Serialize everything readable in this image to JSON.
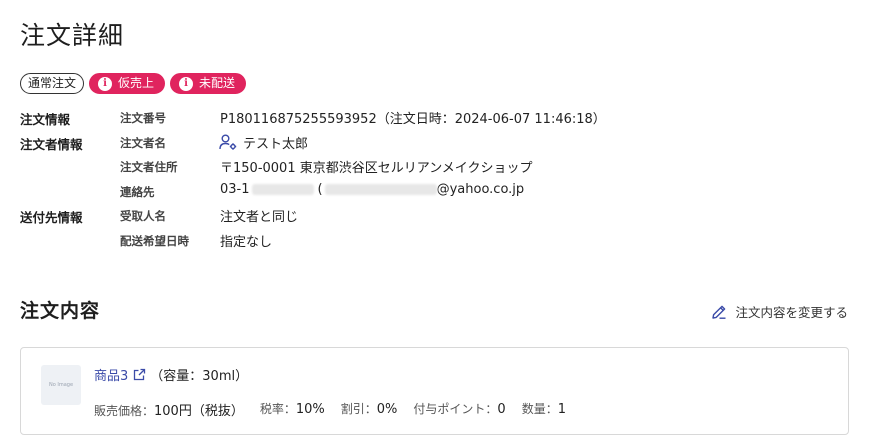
{
  "page_title": "注文詳細",
  "badges": {
    "order_type": "通常注文",
    "status_1": "仮売上",
    "status_2": "未配送"
  },
  "order_info": {
    "section_label": "注文情報",
    "order_number_label": "注文番号",
    "order_number_value": "P180116875255593952（注文日時：2024-06-07 11:46:18）"
  },
  "orderer_info": {
    "section_label": "注文者情報",
    "name_label": "注文者名",
    "name_value": "テスト太郎",
    "address_label": "注文者住所",
    "address_value": "〒150-0001 東京都渋谷区セルリアンメイクショップ",
    "contact_label": "連絡先",
    "contact_phone_prefix": "03-1",
    "contact_email_suffix": "@yahoo.co.jp"
  },
  "shipping_info": {
    "section_label": "送付先情報",
    "recipient_label": "受取人名",
    "recipient_value": "注文者と同じ",
    "delivery_date_label": "配送希望日時",
    "delivery_date_value": "指定なし"
  },
  "order_contents": {
    "title": "注文内容",
    "edit_label": "注文内容を変更する"
  },
  "product": {
    "thumbnail_text": "No Image",
    "name": "商品3",
    "spec": "（容量：30ml）",
    "price_label": "販売価格：",
    "price_value": "100円（税抜）",
    "tax_label": "税率：",
    "tax_value": "10%",
    "discount_label": "割引：",
    "discount_value": "0%",
    "points_label": "付与ポイント：",
    "points_value": "0",
    "quantity_label": "数量：",
    "quantity_value": "1"
  },
  "colors": {
    "status_badge": "#e0245e",
    "link": "#3b4ba8"
  }
}
